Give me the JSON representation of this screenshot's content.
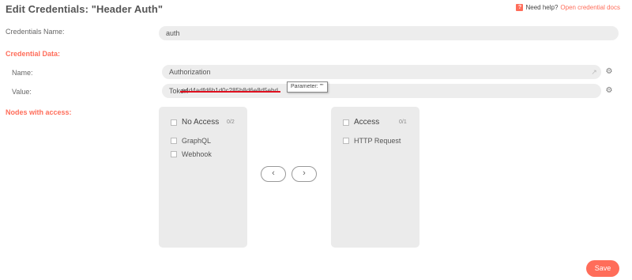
{
  "header": {
    "title": "Edit Credentials: \"Header Auth\"",
    "help_prefix": "Need help?",
    "help_link": "Open credential docs",
    "help_icon": "?"
  },
  "credentials_name": {
    "label": "Credentials Name:",
    "value": "auth"
  },
  "credential_data": {
    "section_label": "Credential Data:",
    "name_label": "Name:",
    "name_value": "Authorization",
    "value_label": "Value:",
    "value_prefix": "Token",
    "value_redacted": "e4d4adfd6b1d0c285b8d6e8d5ebdc",
    "tooltip": "Parameter: \"\""
  },
  "nodes": {
    "section_label": "Nodes with access:",
    "no_access": {
      "title": "No Access",
      "count": "0/2",
      "items": [
        "GraphQL",
        "Webhook"
      ]
    },
    "access": {
      "title": "Access",
      "count": "0/1",
      "items": [
        "HTTP Request"
      ]
    },
    "move_left": "‹",
    "move_right": "›"
  },
  "footer": {
    "save_label": "Save"
  },
  "colors": {
    "accent": "#ff6d5a",
    "panel_bg": "#ebebeb",
    "input_bg": "#ededed",
    "redact_line": "#e0101f"
  }
}
